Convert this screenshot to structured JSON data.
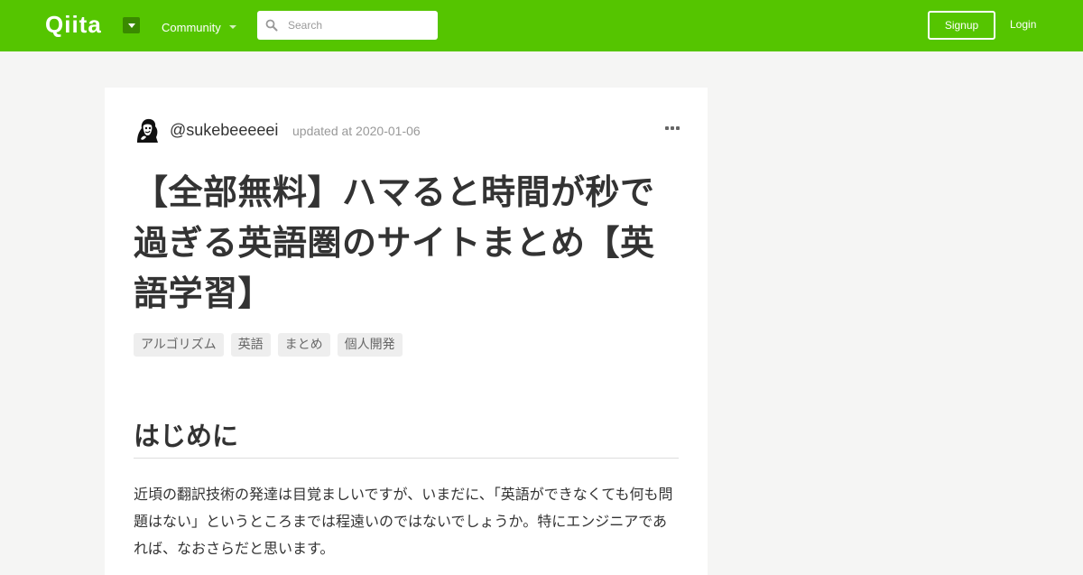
{
  "header": {
    "logo_text": "Qiita",
    "community_label": "Community",
    "search_placeholder": "Search",
    "signup_label": "Signup",
    "login_label": "Login",
    "brand_color": "#55c500"
  },
  "article": {
    "author": "@sukebeeeeei",
    "updated": "updated at 2020-01-06",
    "title": "【全部無料】ハマると時間が秒で過ぎる英語圏のサイトまとめ【英語学習】",
    "tags": [
      "アルゴリズム",
      "英語",
      "まとめ",
      "個人開発"
    ],
    "section_heading": "はじめに",
    "body": "近頃の翻訳技術の発達は目覚ましいですが、いまだに、「英語ができなくても何も問題はない」というところまでは程遠いのではないでしょうか。特にエンジニアであれば、なおさらだと思います。"
  },
  "icons": {
    "search": "search-icon",
    "menu": "chevron-down-icon",
    "more": "more-options-icon",
    "avatar": "avatar"
  }
}
